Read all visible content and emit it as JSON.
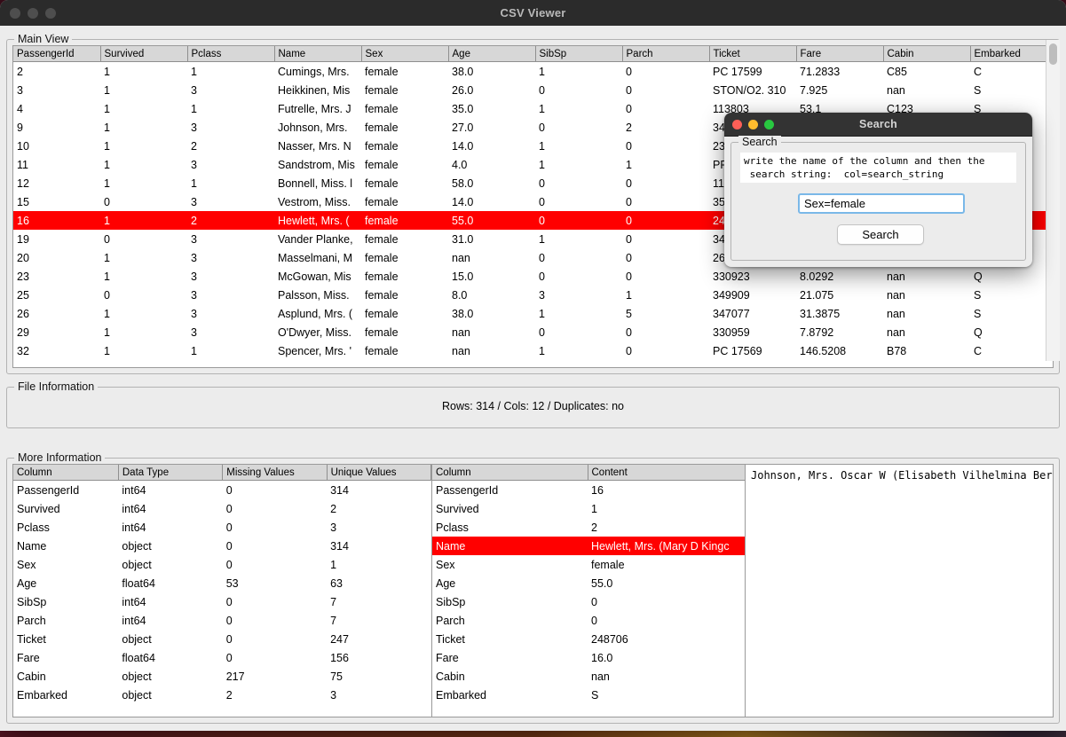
{
  "window": {
    "title": "CSV Viewer",
    "traffic_lights": [
      "close-button",
      "minimize-button",
      "zoom-button"
    ]
  },
  "main_view": {
    "group_title": "Main View",
    "columns": [
      "PassengerId",
      "Survived",
      "Pclass",
      "Name",
      "Sex",
      "Age",
      "SibSp",
      "Parch",
      "Ticket",
      "Fare",
      "Cabin",
      "Embarked"
    ],
    "selected_row_index": 8,
    "rows": [
      [
        "2",
        "1",
        "1",
        "Cumings, Mrs.",
        "female",
        "38.0",
        "1",
        "0",
        "PC 17599",
        "71.2833",
        "C85",
        "C"
      ],
      [
        "3",
        "1",
        "3",
        "Heikkinen, Mis",
        "female",
        "26.0",
        "0",
        "0",
        "STON/O2. 310",
        "7.925",
        "nan",
        "S"
      ],
      [
        "4",
        "1",
        "1",
        "Futrelle, Mrs. J",
        "female",
        "35.0",
        "1",
        "0",
        "113803",
        "53.1",
        "C123",
        "S"
      ],
      [
        "9",
        "1",
        "3",
        "Johnson, Mrs.",
        "female",
        "27.0",
        "0",
        "2",
        "34",
        "",
        "",
        ""
      ],
      [
        "10",
        "1",
        "2",
        "Nasser, Mrs. N",
        "female",
        "14.0",
        "1",
        "0",
        "23",
        "",
        "",
        ""
      ],
      [
        "11",
        "1",
        "3",
        "Sandstrom, Mis",
        "female",
        "4.0",
        "1",
        "1",
        "PP",
        "",
        "",
        ""
      ],
      [
        "12",
        "1",
        "1",
        "Bonnell, Miss. l",
        "female",
        "58.0",
        "0",
        "0",
        "11",
        "",
        "",
        ""
      ],
      [
        "15",
        "0",
        "3",
        "Vestrom, Miss.",
        "female",
        "14.0",
        "0",
        "0",
        "35",
        "",
        "",
        ""
      ],
      [
        "16",
        "1",
        "2",
        "Hewlett, Mrs. (",
        "female",
        "55.0",
        "0",
        "0",
        "24",
        "",
        "",
        ""
      ],
      [
        "19",
        "0",
        "3",
        "Vander Planke,",
        "female",
        "31.0",
        "1",
        "0",
        "34",
        "",
        "",
        ""
      ],
      [
        "20",
        "1",
        "3",
        "Masselmani, M",
        "female",
        "nan",
        "0",
        "0",
        "26",
        "",
        "",
        ""
      ],
      [
        "23",
        "1",
        "3",
        "McGowan, Mis",
        "female",
        "15.0",
        "0",
        "0",
        "330923",
        "8.0292",
        "nan",
        "Q"
      ],
      [
        "25",
        "0",
        "3",
        "Palsson, Miss.",
        "female",
        "8.0",
        "3",
        "1",
        "349909",
        "21.075",
        "nan",
        "S"
      ],
      [
        "26",
        "1",
        "3",
        "Asplund, Mrs. (",
        "female",
        "38.0",
        "1",
        "5",
        "347077",
        "31.3875",
        "nan",
        "S"
      ],
      [
        "29",
        "1",
        "3",
        "O'Dwyer, Miss.",
        "female",
        "nan",
        "0",
        "0",
        "330959",
        "7.8792",
        "nan",
        "Q"
      ],
      [
        "32",
        "1",
        "1",
        "Spencer, Mrs. '",
        "female",
        "nan",
        "1",
        "0",
        "PC 17569",
        "146.5208",
        "B78",
        "C"
      ]
    ]
  },
  "file_information": {
    "group_title": "File Information",
    "summary": "Rows: 314 / Cols: 12 / Duplicates: no"
  },
  "more_information": {
    "group_title": "More Information",
    "schema_table": {
      "columns": [
        "Column",
        "Data Type",
        "Missing Values",
        "Unique Values"
      ],
      "rows": [
        [
          "PassengerId",
          "int64",
          "0",
          "314"
        ],
        [
          "Survived",
          "int64",
          "0",
          "2"
        ],
        [
          "Pclass",
          "int64",
          "0",
          "3"
        ],
        [
          "Name",
          "object",
          "0",
          "314"
        ],
        [
          "Sex",
          "object",
          "0",
          "1"
        ],
        [
          "Age",
          "float64",
          "53",
          "63"
        ],
        [
          "SibSp",
          "int64",
          "0",
          "7"
        ],
        [
          "Parch",
          "int64",
          "0",
          "7"
        ],
        [
          "Ticket",
          "object",
          "0",
          "247"
        ],
        [
          "Fare",
          "float64",
          "0",
          "156"
        ],
        [
          "Cabin",
          "object",
          "217",
          "75"
        ],
        [
          "Embarked",
          "object",
          "2",
          "3"
        ]
      ]
    },
    "record_table": {
      "columns": [
        "Column",
        "Content"
      ],
      "selected_row_index": 3,
      "rows": [
        [
          "PassengerId",
          "16"
        ],
        [
          "Survived",
          "1"
        ],
        [
          "Pclass",
          "2"
        ],
        [
          "Name",
          "Hewlett, Mrs. (Mary D Kingc"
        ],
        [
          "Sex",
          "female"
        ],
        [
          "Age",
          "55.0"
        ],
        [
          "SibSp",
          "0"
        ],
        [
          "Parch",
          "0"
        ],
        [
          "Ticket",
          "248706"
        ],
        [
          "Fare",
          "16.0"
        ],
        [
          "Cabin",
          "nan"
        ],
        [
          "Embarked",
          "S"
        ]
      ]
    },
    "detail_text": "Johnson, Mrs. Oscar W (Elisabeth Vilhelmina Berg)"
  },
  "search_dialog": {
    "title": "Search",
    "group_title": "Search",
    "hint": "write the name of the column and then the\n search string:  col=search_string",
    "input_value": "Sex=female",
    "input_placeholder": "col=search_string",
    "button_label": "Search"
  },
  "colors": {
    "selection": "#ff0000",
    "titlebar": "#2b2b2b",
    "window_bg": "#ececec",
    "focus_ring": "#7ab8e8"
  }
}
